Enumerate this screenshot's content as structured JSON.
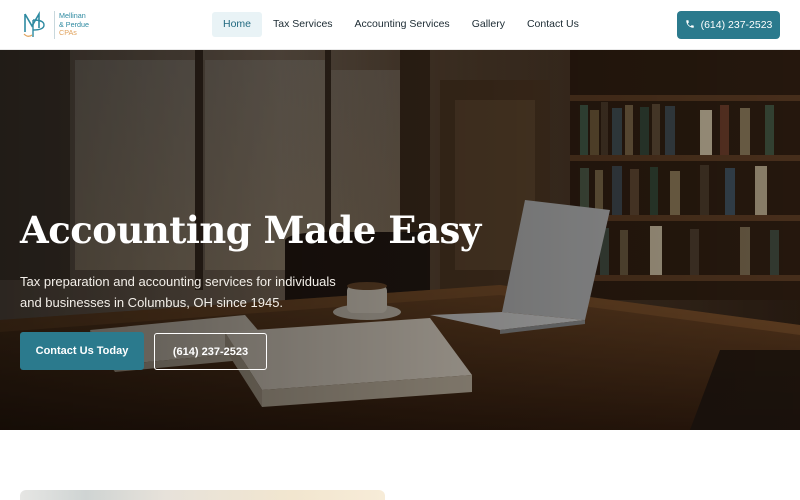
{
  "brand": {
    "line1": "Mellinan",
    "line2": "& Perdue",
    "line3": "CPAs",
    "logo_icon": "mp-monogram-icon"
  },
  "nav": {
    "items": [
      {
        "label": "Home",
        "active": true
      },
      {
        "label": "Tax Services",
        "active": false
      },
      {
        "label": "Accounting Services",
        "active": false
      },
      {
        "label": "Gallery",
        "active": false
      },
      {
        "label": "Contact Us",
        "active": false
      }
    ],
    "phone_label": "(614) 237-2523",
    "phone_icon": "phone-icon"
  },
  "hero": {
    "title": "Accounting Made Easy",
    "subtitle": "Tax preparation and accounting services for individuals and businesses in Columbus, OH since 1945.",
    "primary_cta": "Contact Us Today",
    "secondary_cta": "(614) 237-2523"
  },
  "colors": {
    "accent": "#2b7a8d",
    "logo_teal": "#2e8aa1",
    "logo_gold": "#e0a25c",
    "nav_active_bg": "#e9f3f6"
  }
}
